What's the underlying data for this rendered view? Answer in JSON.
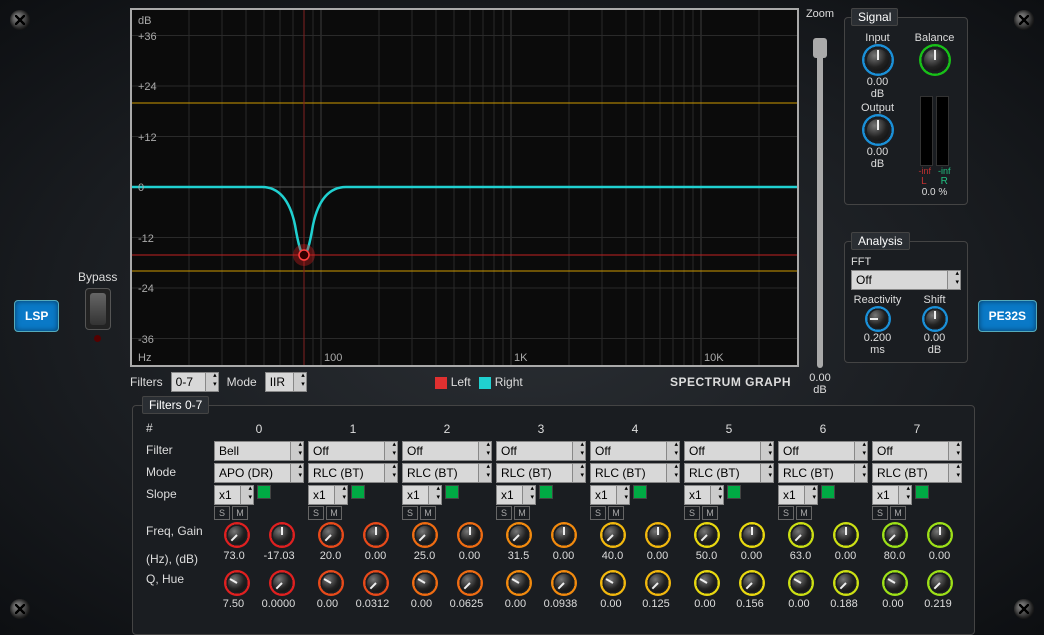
{
  "logo_left": "LSP",
  "logo_right": "PE32S",
  "bypass_label": "Bypass",
  "zoom": {
    "label": "Zoom",
    "value": "0.00",
    "unit": "dB"
  },
  "graph": {
    "y_unit": "dB",
    "y_ticks": [
      "+36",
      "+24",
      "+12",
      "0",
      "-12",
      "-24",
      "-36"
    ],
    "x_unit": "Hz",
    "x_ticks": [
      "100",
      "1K",
      "10K"
    ]
  },
  "filters_bar": {
    "filters_label": "Filters",
    "filters_value": "0-7",
    "mode_label": "Mode",
    "mode_value": "IIR",
    "left_label": "Left",
    "right_label": "Right",
    "left_color": "#e03030",
    "right_color": "#20d0d0"
  },
  "spectrum_graph": "SPECTRUM GRAPH",
  "signal": {
    "legend": "Signal",
    "input_label": "Input",
    "balance_label": "Balance",
    "input_value": "0.00",
    "input_unit": "dB",
    "output_label": "Output",
    "output_value": "0.00",
    "output_unit": "dB",
    "meter_l_label": "L",
    "meter_r_label": "R",
    "meter_l_value": "-inf",
    "meter_r_value": "-inf",
    "meter_pct": "0.0 %"
  },
  "analysis": {
    "legend": "Analysis",
    "fft_label": "FFT",
    "fft_value": "Off",
    "react_label": "Reactivity",
    "shift_label": "Shift",
    "react_value": "0.200",
    "react_unit": "ms",
    "shift_value": "0.00",
    "shift_unit": "dB"
  },
  "filters_panel": {
    "legend": "Filters 0-7",
    "row_index": "#",
    "row_filter": "Filter",
    "row_mode": "Mode",
    "row_slope": "Slope",
    "row_fg": "Freq, Gain",
    "row_fg2": "(Hz), (dB)",
    "row_qh": "Q, Hue",
    "cols": [
      {
        "idx": "0",
        "filter": "Bell",
        "mode": "APO (DR)",
        "slope": "x1",
        "freq": "73.0",
        "gain": "-17.03",
        "q": "7.50",
        "hue": "0.0000",
        "color": "#e02020"
      },
      {
        "idx": "1",
        "filter": "Off",
        "mode": "RLC (BT)",
        "slope": "x1",
        "freq": "20.0",
        "gain": "0.00",
        "q": "0.00",
        "hue": "0.0312",
        "color": "#e84a1a"
      },
      {
        "idx": "2",
        "filter": "Off",
        "mode": "RLC (BT)",
        "slope": "x1",
        "freq": "25.0",
        "gain": "0.00",
        "q": "0.00",
        "hue": "0.0625",
        "color": "#ef6c12"
      },
      {
        "idx": "3",
        "filter": "Off",
        "mode": "RLC (BT)",
        "slope": "x1",
        "freq": "31.5",
        "gain": "0.00",
        "q": "0.00",
        "hue": "0.0938",
        "color": "#f28a0e"
      },
      {
        "idx": "4",
        "filter": "Off",
        "mode": "RLC (BT)",
        "slope": "x1",
        "freq": "40.0",
        "gain": "0.00",
        "q": "0.00",
        "hue": "0.125",
        "color": "#f2b80e"
      },
      {
        "idx": "5",
        "filter": "Off",
        "mode": "RLC (BT)",
        "slope": "x1",
        "freq": "50.0",
        "gain": "0.00",
        "q": "0.00",
        "hue": "0.156",
        "color": "#e8d810"
      },
      {
        "idx": "6",
        "filter": "Off",
        "mode": "RLC (BT)",
        "slope": "x1",
        "freq": "63.0",
        "gain": "0.00",
        "q": "0.00",
        "hue": "0.188",
        "color": "#cce014"
      },
      {
        "idx": "7",
        "filter": "Off",
        "mode": "RLC (BT)",
        "slope": "x1",
        "freq": "80.0",
        "gain": "0.00",
        "q": "0.00",
        "hue": "0.219",
        "color": "#9de018"
      }
    ]
  },
  "chart_data": {
    "type": "line",
    "title": "",
    "xlabel": "Hz",
    "ylabel": "dB",
    "x_scale": "log",
    "xlim": [
      10,
      24000
    ],
    "ylim": [
      -42,
      42
    ],
    "x_ticks": [
      100,
      1000,
      10000
    ],
    "y_ticks": [
      -36,
      -24,
      -12,
      0,
      12,
      24,
      36
    ],
    "gridlines_y": [
      -20,
      20
    ],
    "series": [
      {
        "name": "Left",
        "color": "#e03030",
        "constant": -20
      },
      {
        "name": "Right",
        "color": "#20d0d0",
        "shape": "bell_notch",
        "baseline": 0,
        "center_hz": 73.0,
        "depth_db": -20,
        "q": 7.5
      }
    ],
    "markers": [
      {
        "x_hz": 73.0,
        "y_db": -20,
        "shape": "circle",
        "color": "#e03030"
      }
    ]
  }
}
